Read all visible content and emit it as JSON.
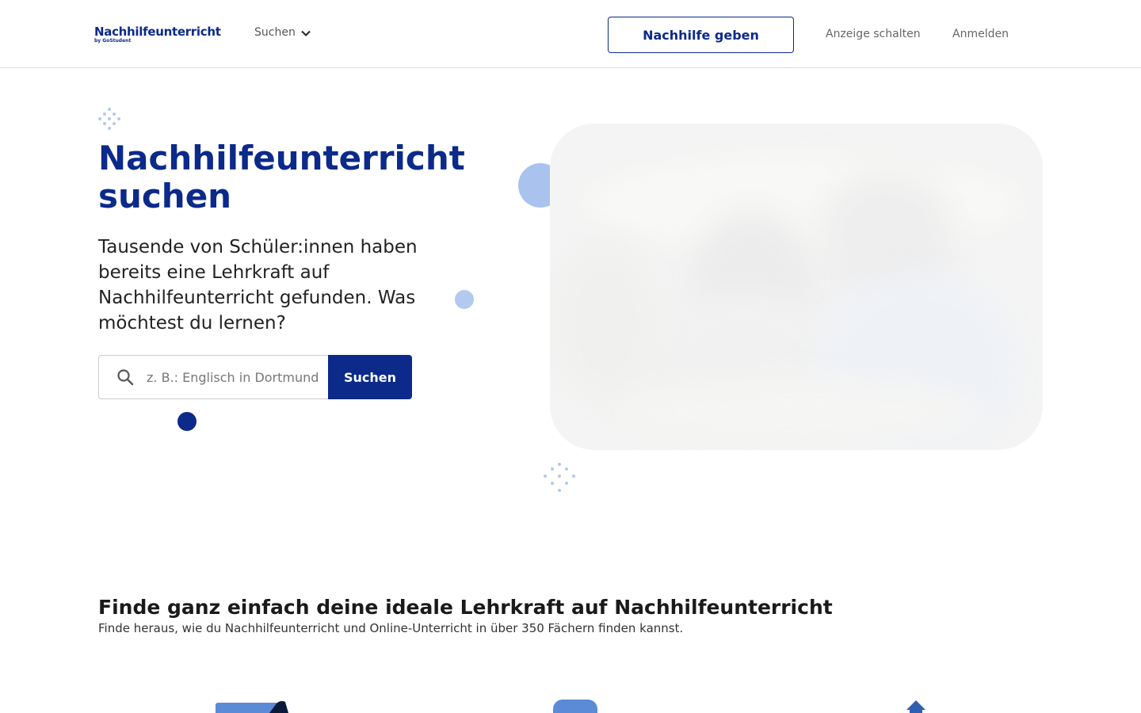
{
  "header": {
    "logo_main": "Nachhilfeunterricht",
    "logo_sub": "by GoStudent",
    "nav_search_label": "Suchen",
    "give_tutoring_label": "Nachhilfe geben",
    "post_ad_label": "Anzeige schalten",
    "login_label": "Anmelden"
  },
  "hero": {
    "title": "Nachhilfeunterricht suchen",
    "subtitle": "Tausende von Schüler:innen haben bereits eine Lehrkraft auf Nachhilfeunterricht gefunden. Was möchtest du lernen?",
    "search_placeholder": "z. B.: Englisch in Dortmund",
    "search_button_label": "Suchen"
  },
  "section": {
    "title": "Finde ganz einfach deine ideale Lehrkraft auf Nachhilfeunterricht",
    "subtitle": "Finde heraus, wie du Nachhilfeunterricht und Online-Unterricht in über 350 Fächern finden kannst."
  },
  "colors": {
    "brand": "#0b2a8a",
    "accent_light": "#a9c3ee"
  }
}
